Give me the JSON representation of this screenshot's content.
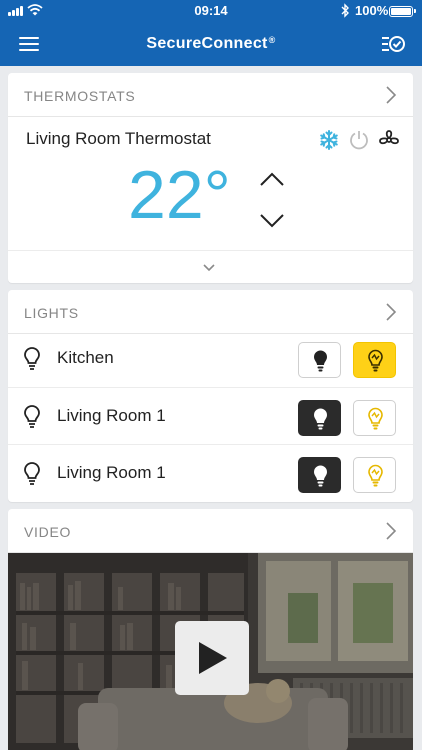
{
  "status_bar": {
    "time": "09:14",
    "battery": "100%",
    "icons": [
      "signal-icon",
      "wifi-icon",
      "bluetooth-icon",
      "battery-icon"
    ]
  },
  "app_bar": {
    "title": "SecureConnect",
    "title_mark": "®",
    "icons": [
      "menu-icon",
      "tasks-icon"
    ]
  },
  "thermostats": {
    "header": "THERMOSTATS",
    "device_name": "Living Room Thermostat",
    "temperature": "22°",
    "mode_icons": [
      "snowflake-icon",
      "power-icon",
      "fan-icon"
    ],
    "active_mode": "cool",
    "temp_color": "#3fb3de"
  },
  "lights": {
    "header": "LIGHTS",
    "items": [
      {
        "label": "Kitchen",
        "state": "on"
      },
      {
        "label": "Living Room 1",
        "state": "off"
      },
      {
        "label": "Living Room 1",
        "state": "off"
      }
    ],
    "on_color": "#fed117",
    "off_color": "#2b2b2b"
  },
  "video": {
    "header": "VIDEO",
    "icons": [
      "play-icon"
    ]
  },
  "colors": {
    "brand": "#1565b4",
    "background": "#e9ebee"
  }
}
